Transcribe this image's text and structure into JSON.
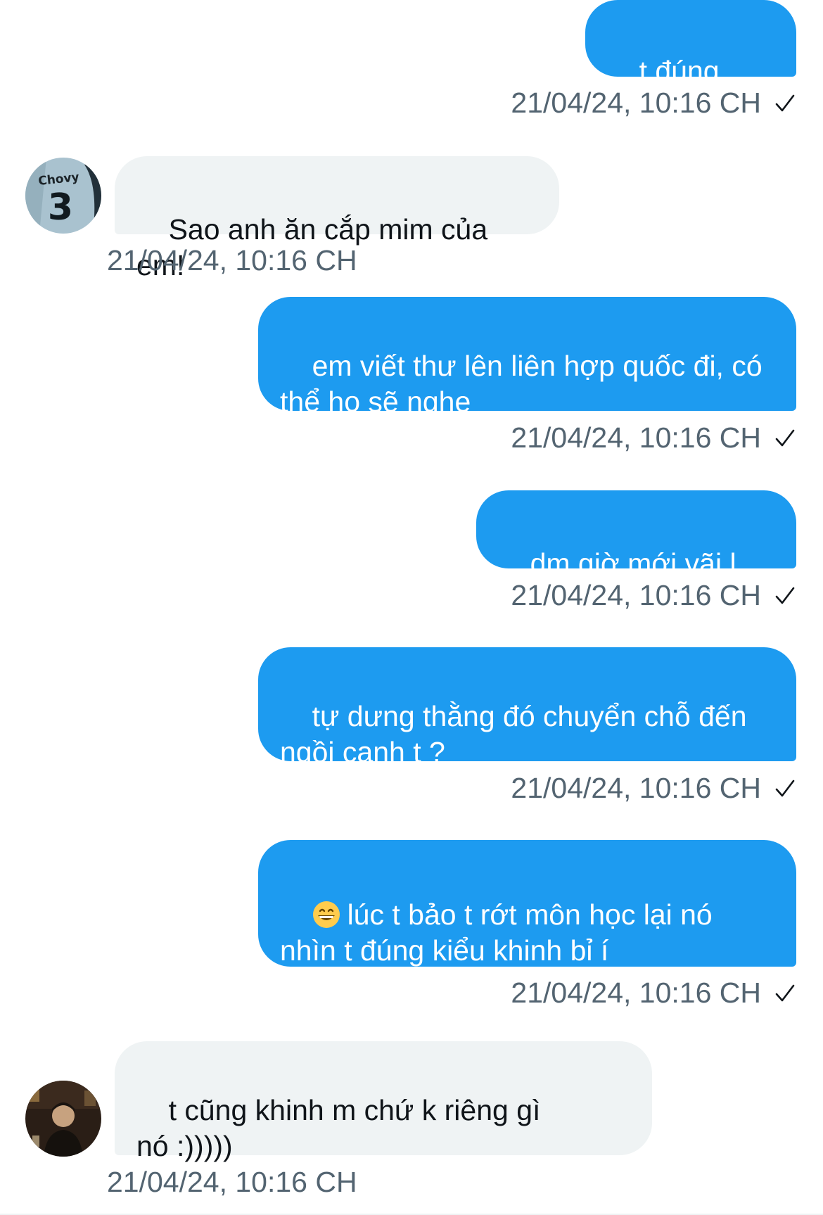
{
  "colors": {
    "outgoing_bubble": "#1d9bf0",
    "incoming_bubble": "#eff3f4",
    "timestamp": "#536471",
    "text_dark": "#0f1419"
  },
  "messages": [
    {
      "direction": "out",
      "text": "t đúng kiểu:",
      "time": "21/04/24, 10:16 CH",
      "status_icon": "sent-check-icon"
    },
    {
      "direction": "in",
      "text": "Sao anh ăn cắp mim của em!",
      "time": "21/04/24, 10:16 CH",
      "avatar": "jersey-avatar",
      "avatar_text": "Chovy",
      "avatar_number": "3"
    },
    {
      "direction": "out",
      "text": "em viết thư lên liên hợp quốc đi, có\nthể họ sẽ nghe",
      "time": "21/04/24, 10:16 CH",
      "status_icon": "sent-check-icon"
    },
    {
      "direction": "out",
      "text": "dm giờ mới vãi l này",
      "time": "21/04/24, 10:16 CH",
      "status_icon": "sent-check-icon"
    },
    {
      "direction": "out",
      "text": "tự dưng thằng đó chuyển chỗ đến\nngồi cạnh t ?",
      "time": "21/04/24, 10:16 CH",
      "status_icon": "sent-check-icon"
    },
    {
      "direction": "out",
      "emoji": "grinning-face-icon",
      "text": "lúc t bảo t rớt môn học lại nó\nnhìn t đúng kiểu khinh bỉ í",
      "time": "21/04/24, 10:16 CH",
      "status_icon": "sent-check-icon"
    },
    {
      "direction": "in",
      "text": "t cũng khinh m chứ k riêng gì\nnó :)))))",
      "time": "21/04/24, 10:16 CH",
      "avatar": "photo-avatar"
    }
  ]
}
